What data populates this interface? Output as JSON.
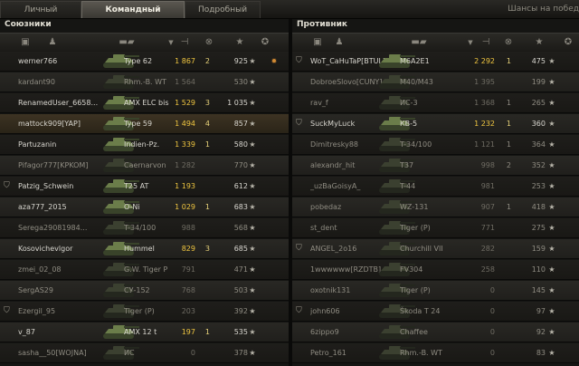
{
  "tabs": [
    {
      "label": "Личный результат",
      "active": false
    },
    {
      "label": "Командный результат",
      "active": true
    },
    {
      "label": "Подробный отчёт",
      "active": false
    }
  ],
  "chance_label": "Шансы на побед",
  "allies": {
    "title": "Союзники",
    "rows": [
      {
        "name": "werner766",
        "vehicle": "Type 62",
        "damage": "1 867",
        "kills": "2",
        "xp": "925",
        "alive": true,
        "platoon": false,
        "self": false,
        "medal": true
      },
      {
        "name": "kardant90",
        "vehicle": "Rhm.-B. WT",
        "damage": "1 564",
        "kills": "",
        "xp": "530",
        "alive": false,
        "platoon": false,
        "self": false,
        "medal": false
      },
      {
        "name": "RenamedUser_6658...",
        "vehicle": "AMX ELC bis",
        "damage": "1 529",
        "kills": "3",
        "xp": "1 035",
        "alive": true,
        "platoon": false,
        "self": false,
        "medal": false
      },
      {
        "name": "mattock909[YAP]",
        "vehicle": "Type 59",
        "damage": "1 494",
        "kills": "4",
        "xp": "857",
        "alive": true,
        "platoon": false,
        "self": true,
        "medal": false
      },
      {
        "name": "Partuzanin",
        "vehicle": "Indien-Pz.",
        "damage": "1 339",
        "kills": "1",
        "xp": "580",
        "alive": true,
        "platoon": false,
        "self": false,
        "medal": false
      },
      {
        "name": "Pifagor777[KPKOM]",
        "vehicle": "Caernarvon",
        "damage": "1 282",
        "kills": "",
        "xp": "770",
        "alive": false,
        "platoon": false,
        "self": false,
        "medal": false
      },
      {
        "name": "Patzig_Schwein",
        "vehicle": "T25 AT",
        "damage": "1 193",
        "kills": "",
        "xp": "612",
        "alive": true,
        "platoon": true,
        "self": false,
        "medal": false
      },
      {
        "name": "aza777_2015",
        "vehicle": "O-Ni",
        "damage": "1 029",
        "kills": "1",
        "xp": "683",
        "alive": true,
        "platoon": false,
        "self": false,
        "medal": false
      },
      {
        "name": "Serega29081984...",
        "vehicle": "T-34/100",
        "damage": "988",
        "kills": "",
        "xp": "568",
        "alive": false,
        "platoon": false,
        "self": false,
        "medal": false
      },
      {
        "name": "Kosovichevlgor",
        "vehicle": "Hummel",
        "damage": "829",
        "kills": "3",
        "xp": "685",
        "alive": true,
        "platoon": false,
        "self": false,
        "medal": false
      },
      {
        "name": "zmei_02_08",
        "vehicle": "G.W. Tiger P",
        "damage": "791",
        "kills": "",
        "xp": "471",
        "alive": false,
        "platoon": false,
        "self": false,
        "medal": false
      },
      {
        "name": "SergAS29",
        "vehicle": "СУ-152",
        "damage": "768",
        "kills": "",
        "xp": "503",
        "alive": false,
        "platoon": false,
        "self": false,
        "medal": false
      },
      {
        "name": "Ezergil_95",
        "vehicle": "Tiger (P)",
        "damage": "203",
        "kills": "",
        "xp": "392",
        "alive": false,
        "platoon": true,
        "self": false,
        "medal": false
      },
      {
        "name": "v_87",
        "vehicle": "AMX 12 t",
        "damage": "197",
        "kills": "1",
        "xp": "535",
        "alive": true,
        "platoon": false,
        "self": false,
        "medal": false
      },
      {
        "name": "sasha__50[WOJNA]",
        "vehicle": "ИС",
        "damage": "0",
        "kills": "",
        "xp": "378",
        "alive": false,
        "platoon": false,
        "self": false,
        "medal": false
      }
    ]
  },
  "enemies": {
    "title": "Противник",
    "rows": [
      {
        "name": "WoT_CaHuTaP[BTUL]",
        "vehicle": "M6A2E1",
        "damage": "2 292",
        "kills": "1",
        "xp": "475",
        "alive": true,
        "platoon": true
      },
      {
        "name": "DobroeSlovo[CUNY]",
        "vehicle": "M40/M43",
        "damage": "1 395",
        "kills": "",
        "xp": "199",
        "alive": false,
        "platoon": false
      },
      {
        "name": "rav_f",
        "vehicle": "ИС-3",
        "damage": "1 368",
        "kills": "1",
        "xp": "265",
        "alive": false,
        "platoon": false
      },
      {
        "name": "SuckMyLuck",
        "vehicle": "КВ-5",
        "damage": "1 232",
        "kills": "1",
        "xp": "360",
        "alive": true,
        "platoon": true
      },
      {
        "name": "Dimitresky88",
        "vehicle": "T-34/100",
        "damage": "1 121",
        "kills": "1",
        "xp": "364",
        "alive": false,
        "platoon": false
      },
      {
        "name": "alexandr_hit",
        "vehicle": "T37",
        "damage": "998",
        "kills": "2",
        "xp": "352",
        "alive": false,
        "platoon": false
      },
      {
        "name": "_uzBaGoisyA_",
        "vehicle": "T-44",
        "damage": "981",
        "kills": "",
        "xp": "253",
        "alive": false,
        "platoon": false
      },
      {
        "name": "pobedaz",
        "vehicle": "WZ-131",
        "damage": "907",
        "kills": "1",
        "xp": "418",
        "alive": false,
        "platoon": false
      },
      {
        "name": "st_dent",
        "vehicle": "Tiger (P)",
        "damage": "771",
        "kills": "",
        "xp": "275",
        "alive": false,
        "platoon": false
      },
      {
        "name": "ANGEL_2o16",
        "vehicle": "Churchill VII",
        "damage": "282",
        "kills": "",
        "xp": "159",
        "alive": false,
        "platoon": true
      },
      {
        "name": "1wwwwww[RZDTB]",
        "vehicle": "FV304",
        "damage": "258",
        "kills": "",
        "xp": "110",
        "alive": false,
        "platoon": false
      },
      {
        "name": "oxotnik131",
        "vehicle": "Tiger (P)",
        "damage": "0",
        "kills": "",
        "xp": "145",
        "alive": false,
        "platoon": false
      },
      {
        "name": "john606",
        "vehicle": "Škoda T 24",
        "damage": "0",
        "kills": "",
        "xp": "97",
        "alive": false,
        "platoon": true
      },
      {
        "name": "6zippo9",
        "vehicle": "Chaffee",
        "damage": "0",
        "kills": "",
        "xp": "92",
        "alive": false,
        "platoon": false
      },
      {
        "name": "Petro_161",
        "vehicle": "Rhm.-B. WT",
        "damage": "0",
        "kills": "",
        "xp": "83",
        "alive": false,
        "platoon": false
      }
    ]
  },
  "header_icons": [
    "platoon-icon",
    "player-icon",
    "vehicle-icon",
    "sort-arrow-icon",
    "damage-icon",
    "kills-icon",
    "experience-icon",
    "medal-icon"
  ],
  "colors": {
    "highlight_damage": "#f0c640",
    "self_row": "#3d3323",
    "medal": "#d38b33"
  }
}
